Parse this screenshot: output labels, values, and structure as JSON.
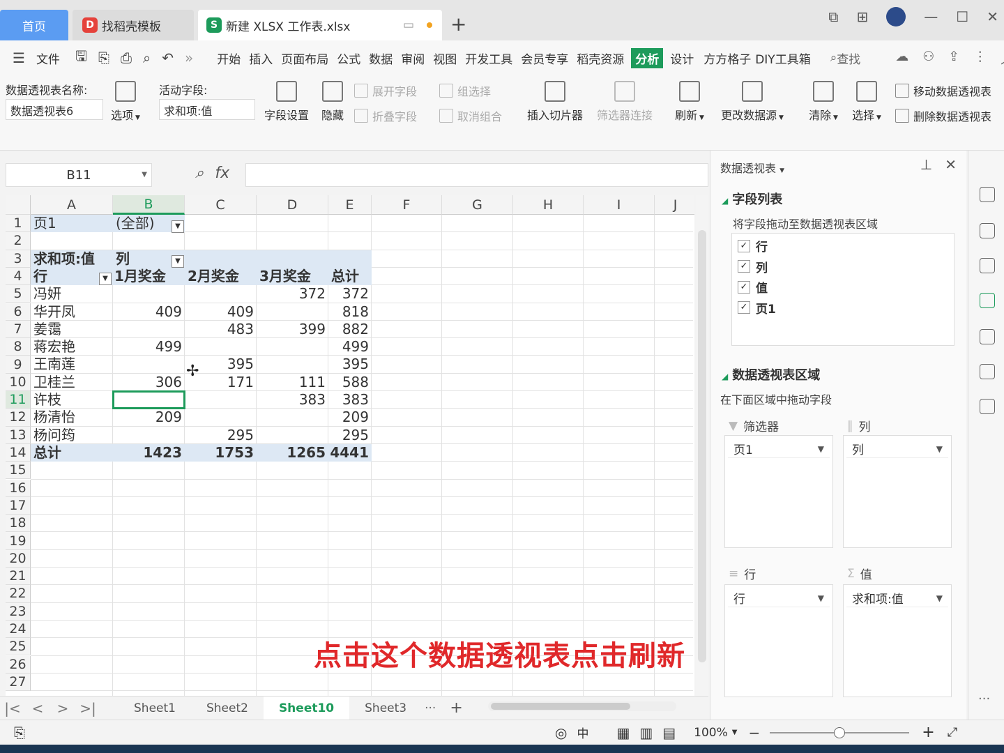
{
  "tabs": {
    "home": "首页",
    "template": "找稻壳模板",
    "document": "新建 XLSX 工作表.xlsx"
  },
  "menu": {
    "file": "文件",
    "items": [
      "开始",
      "插入",
      "页面布局",
      "公式",
      "数据",
      "审阅",
      "视图",
      "开发工具",
      "会员专享",
      "稻壳资源"
    ],
    "active": "分析",
    "design": "设计",
    "extra": [
      "方方格子",
      "DIY工具箱"
    ],
    "search": "查找"
  },
  "ribbon": {
    "pivot_name_label": "数据透视表名称:",
    "pivot_name_value": "数据透视表6",
    "options": "选项",
    "active_field_label": "活动字段:",
    "active_field_value": "求和项:值",
    "field_settings": "字段设置",
    "hide": "隐藏",
    "expand_field": "展开字段",
    "collapse_field": "折叠字段",
    "group_selection": "组选择",
    "ungroup": "取消组合",
    "insert_slicer": "插入切片器",
    "filter_connection": "筛选器连接",
    "refresh": "刷新",
    "change_source": "更改数据源",
    "clear": "清除",
    "select": "选择",
    "move_pivot": "移动数据透视表",
    "delete_pivot": "删除数据透视表"
  },
  "formula_bar": {
    "cell_ref": "B11",
    "fx": "fx",
    "value": ""
  },
  "grid": {
    "columns": [
      "A",
      "B",
      "C",
      "D",
      "E",
      "F",
      "G",
      "H",
      "I",
      "J"
    ],
    "rows": [
      "1",
      "2",
      "3",
      "4",
      "5",
      "6",
      "7",
      "8",
      "9",
      "10",
      "11",
      "12",
      "13",
      "14",
      "15",
      "16",
      "17",
      "18",
      "19",
      "20",
      "21",
      "22",
      "23",
      "24",
      "25",
      "26",
      "27"
    ],
    "selected_cell": "B11"
  },
  "pivot": {
    "page_label": "页1",
    "page_value": "(全部)",
    "value_header": "求和项:值",
    "col_label": "列",
    "row_label": "行",
    "col_headers": [
      "1月奖金",
      "2月奖金",
      "3月奖金",
      "总计"
    ],
    "rows": [
      {
        "name": "冯妍",
        "b": "",
        "c": "",
        "d": "372",
        "e": "372"
      },
      {
        "name": "华开凤",
        "b": "409",
        "c": "409",
        "d": "",
        "e": "818"
      },
      {
        "name": "姜霭",
        "b": "",
        "c": "483",
        "d": "399",
        "e": "882"
      },
      {
        "name": "蒋宏艳",
        "b": "499",
        "c": "",
        "d": "",
        "e": "499"
      },
      {
        "name": "王南莲",
        "b": "",
        "c": "395",
        "d": "",
        "e": "395"
      },
      {
        "name": "卫桂兰",
        "b": "306",
        "c": "171",
        "d": "111",
        "e": "588"
      },
      {
        "name": "许枝",
        "b": "",
        "c": "",
        "d": "383",
        "e": "383"
      },
      {
        "name": "杨清怡",
        "b": "209",
        "c": "",
        "d": "",
        "e": "209"
      },
      {
        "name": "杨问筠",
        "b": "",
        "c": "295",
        "d": "",
        "e": "295"
      }
    ],
    "total": {
      "name": "总计",
      "b": "1423",
      "c": "1753",
      "d": "1265",
      "e": "4441"
    }
  },
  "caption": "点击这个数据透视表点击刷新",
  "sheets": [
    "Sheet1",
    "Sheet2",
    "Sheet10",
    "Sheet3"
  ],
  "active_sheet": "Sheet10",
  "sheet_more": "···",
  "status": {
    "input_mode": "中",
    "zoom": "100%"
  },
  "panel": {
    "title": "数据透视表",
    "field_list_title": "字段列表",
    "field_list_sub": "将字段拖动至数据透视表区域",
    "fields": [
      "行",
      "列",
      "值",
      "页1"
    ],
    "areas_title": "数据透视表区域",
    "areas_sub": "在下面区域中拖动字段",
    "filter_label": "筛选器",
    "filter_value": "页1",
    "columns_label": "列",
    "columns_value": "列",
    "rows_label": "行",
    "rows_value": "行",
    "values_label": "值",
    "values_value": "求和项:值"
  },
  "colors": {
    "accent": "#1d9b5b",
    "home_tab": "#5b9cf2",
    "caption": "#e0282a",
    "pivot_band": "#dde8f4"
  }
}
